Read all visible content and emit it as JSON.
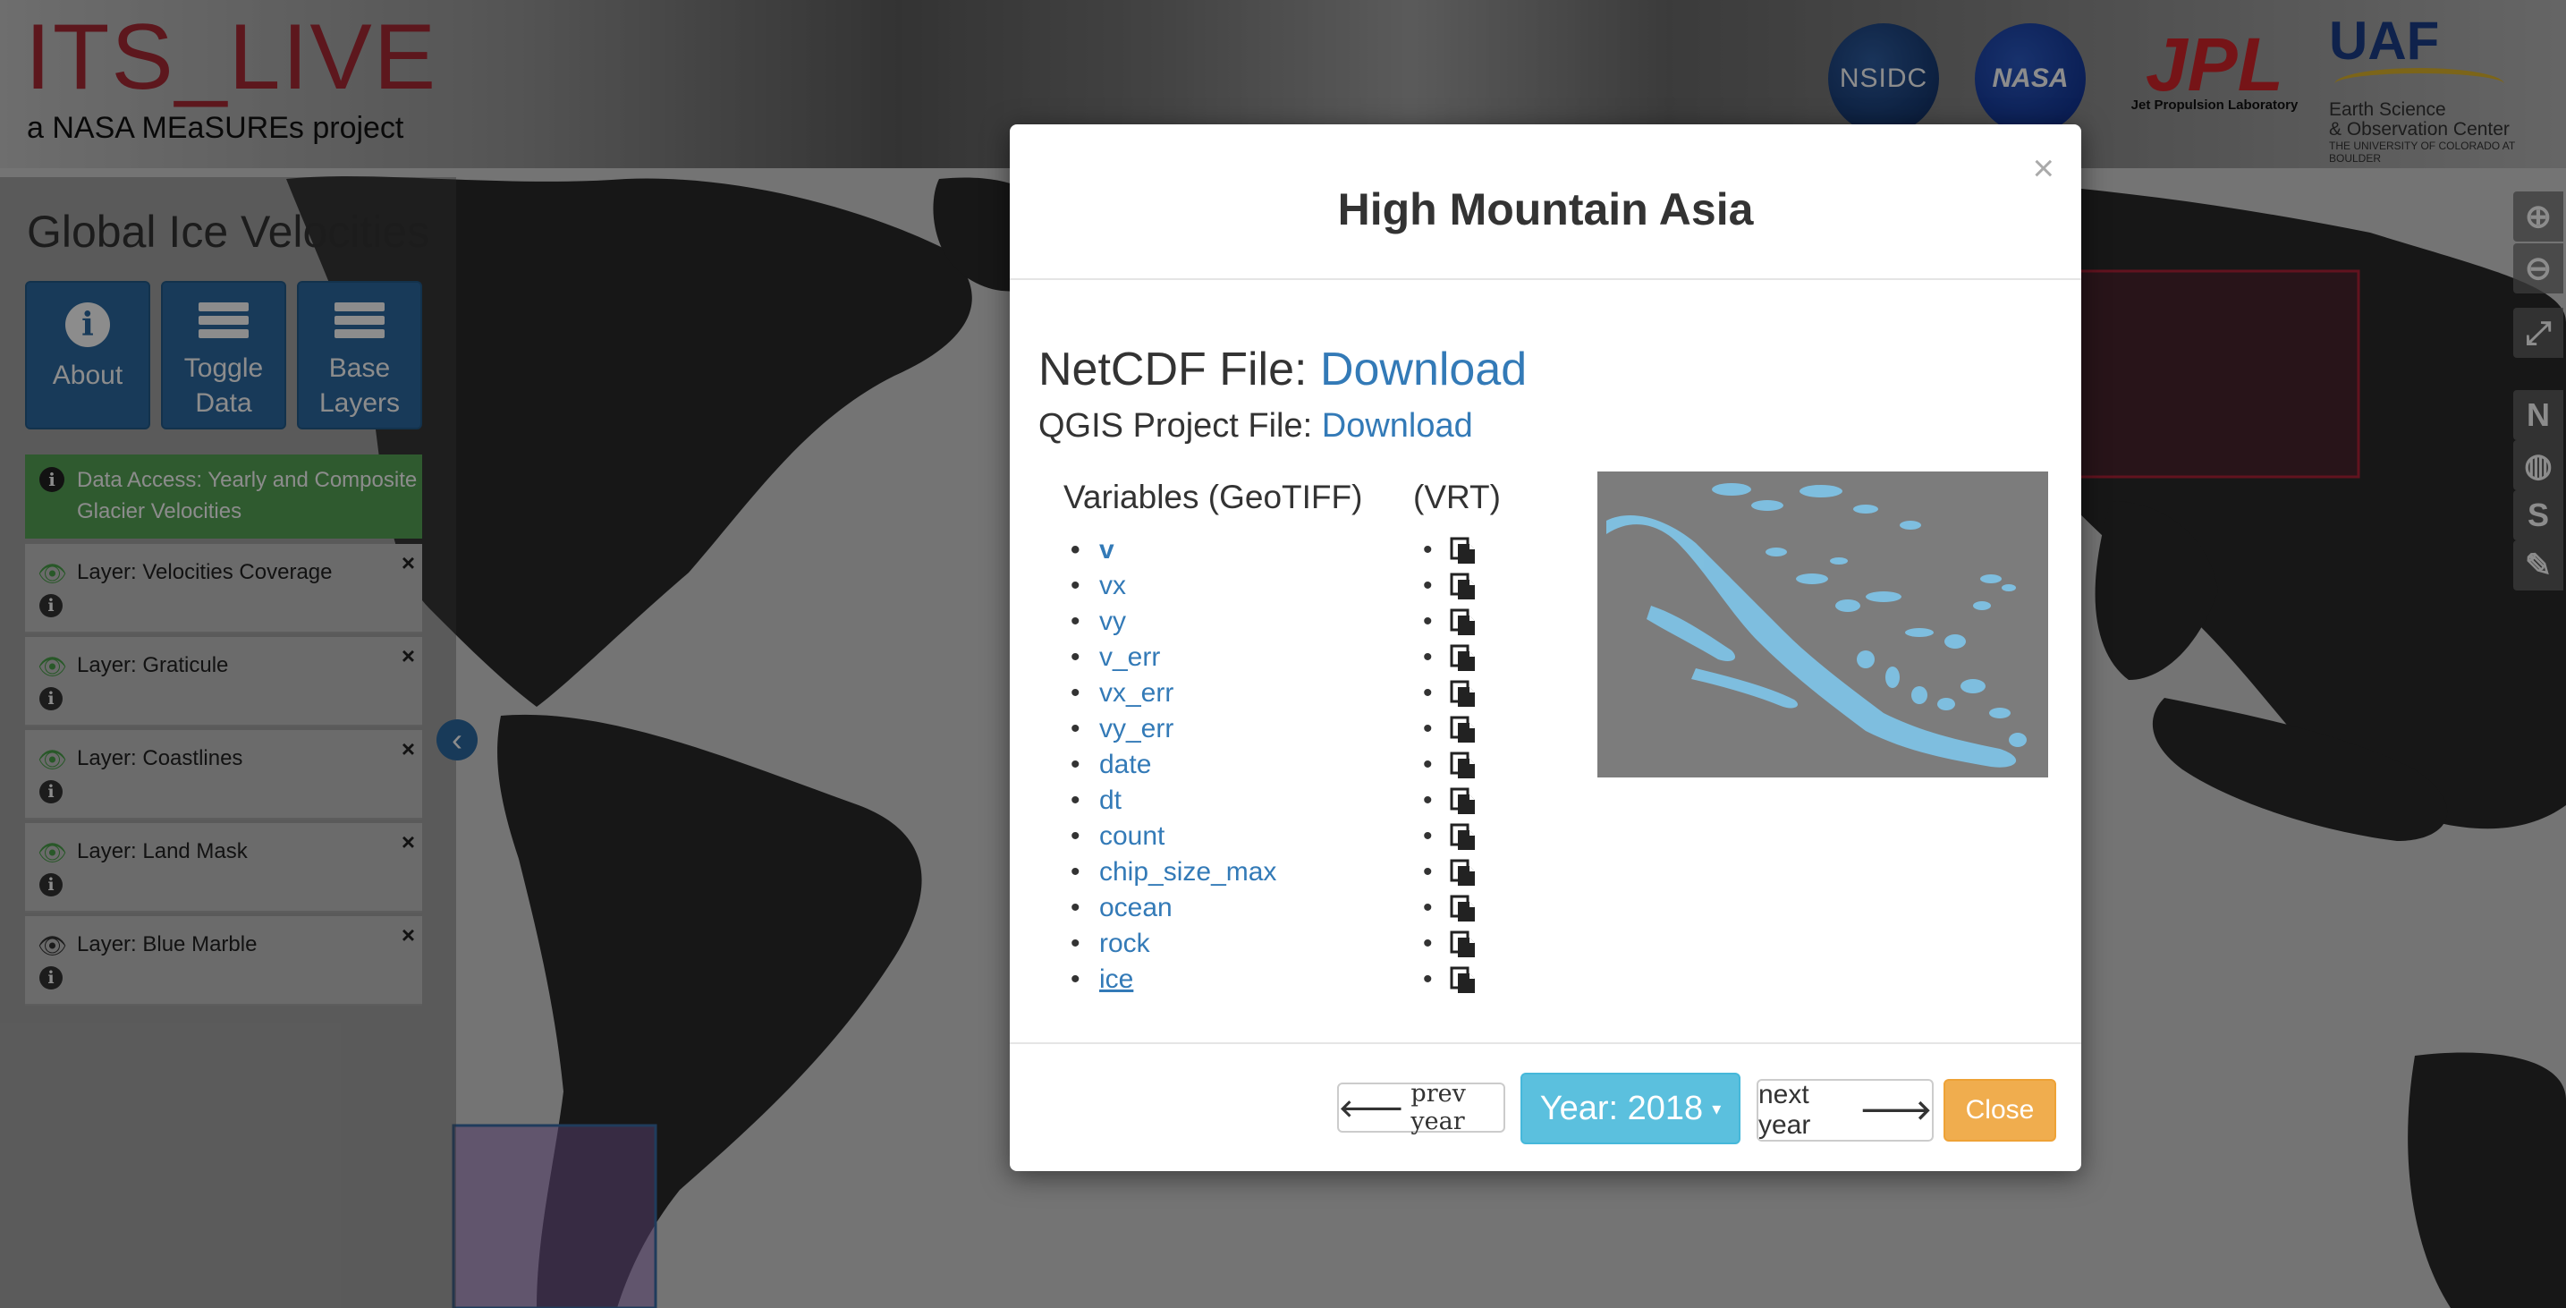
{
  "header": {
    "logo_title": "ITS_LIVE",
    "logo_subtitle": "a NASA MEaSUREs project",
    "partners": {
      "nsidc": "NSIDC",
      "nasa": "NASA",
      "jpl": "JPL",
      "jpl_sub": "Jet Propulsion Laboratory",
      "uaf": "UAF",
      "uaf_line1": "Earth Science",
      "uaf_line2": "& Observation Center",
      "uaf_line3": "THE UNIVERSITY OF COLORADO AT BOULDER"
    }
  },
  "sidebar": {
    "title": "Global Ice Velocities",
    "buttons": [
      {
        "label_1": "About",
        "label_2": ""
      },
      {
        "label_1": "Toggle",
        "label_2": "Data"
      },
      {
        "label_1": "Base",
        "label_2": "Layers"
      }
    ],
    "data_access": "Data Access: Yearly and Composite Glacier Velocities",
    "layers": [
      {
        "name": "Layer: Velocities Coverage"
      },
      {
        "name": "Layer: Graticule"
      },
      {
        "name": "Layer: Coastlines"
      },
      {
        "name": "Layer: Land Mask"
      },
      {
        "name": "Layer: Blue Marble"
      }
    ]
  },
  "right_toolbar": {
    "zoom_in": "zoom-in-icon",
    "zoom_out": "zoom-out-icon",
    "fullscreen": "expand-icon",
    "north": "N",
    "globe": "globe-icon",
    "south": "S",
    "draw": "pencil-icon"
  },
  "modal": {
    "close_x": "×",
    "title": "High Mountain Asia",
    "netcdf_label": "NetCDF File:",
    "netcdf_link": "Download",
    "qgis_label": "QGIS Project File:",
    "qgis_link": "Download",
    "variables_header": "Variables (GeoTIFF)",
    "vrt_header": "(VRT)",
    "variables": [
      "v",
      "vx",
      "vy",
      "v_err",
      "vx_err",
      "vy_err",
      "date",
      "dt",
      "count",
      "chip_size_max",
      "ocean",
      "rock",
      "ice"
    ],
    "footer": {
      "prev_year": "prev year",
      "year": "Year: 2018",
      "next_year": "next year",
      "close": "Close"
    }
  },
  "colors": {
    "brand_red": "#a92b36",
    "button_blue": "#2d6aa3",
    "link_blue": "#337ab7",
    "info_blue": "#5bc0de",
    "warning_orange": "#f0ad4e",
    "success_green": "#57a556"
  }
}
